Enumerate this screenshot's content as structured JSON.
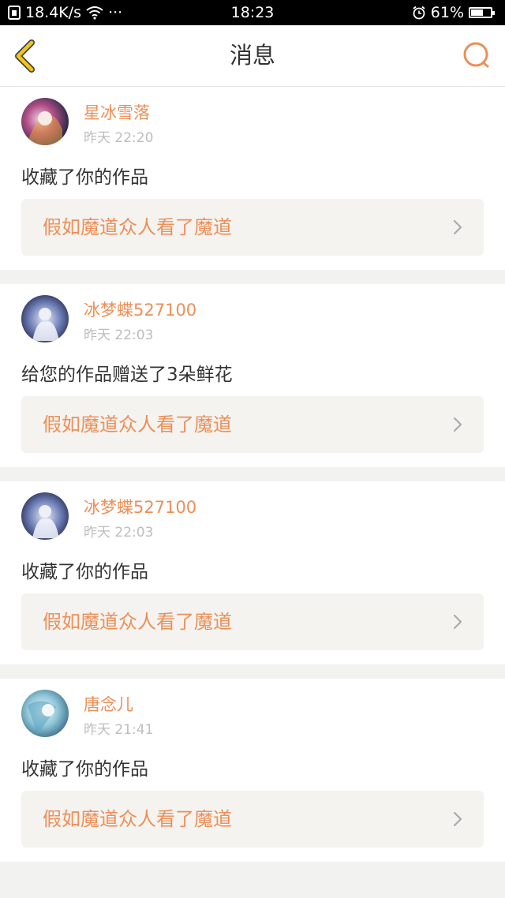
{
  "status_bar": {
    "net_speed": "18.4K/s",
    "dots": "···",
    "time": "18:23",
    "battery": "61%",
    "battery_level": 0.61
  },
  "header": {
    "title": "消息",
    "back_icon": "chevron-left-icon",
    "search_icon": "search-icon"
  },
  "colors": {
    "accent": "#ec8f58",
    "back_icon": "#f3c51b",
    "background": "#f2f2f0",
    "link_bg": "#f4f3ef"
  },
  "messages": [
    {
      "username": "星冰雪落",
      "time": "昨天 22:20",
      "text": "收藏了你的作品",
      "work": "假如魔道众人看了魔道"
    },
    {
      "username": "冰梦蝶527100",
      "time": "昨天 22:03",
      "text": "给您的作品赠送了3朵鲜花",
      "work": "假如魔道众人看了魔道"
    },
    {
      "username": "冰梦蝶527100",
      "time": "昨天 22:03",
      "text": "收藏了你的作品",
      "work": "假如魔道众人看了魔道"
    },
    {
      "username": "唐念儿",
      "time": "昨天 21:41",
      "text": "收藏了你的作品",
      "work": "假如魔道众人看了魔道"
    }
  ]
}
